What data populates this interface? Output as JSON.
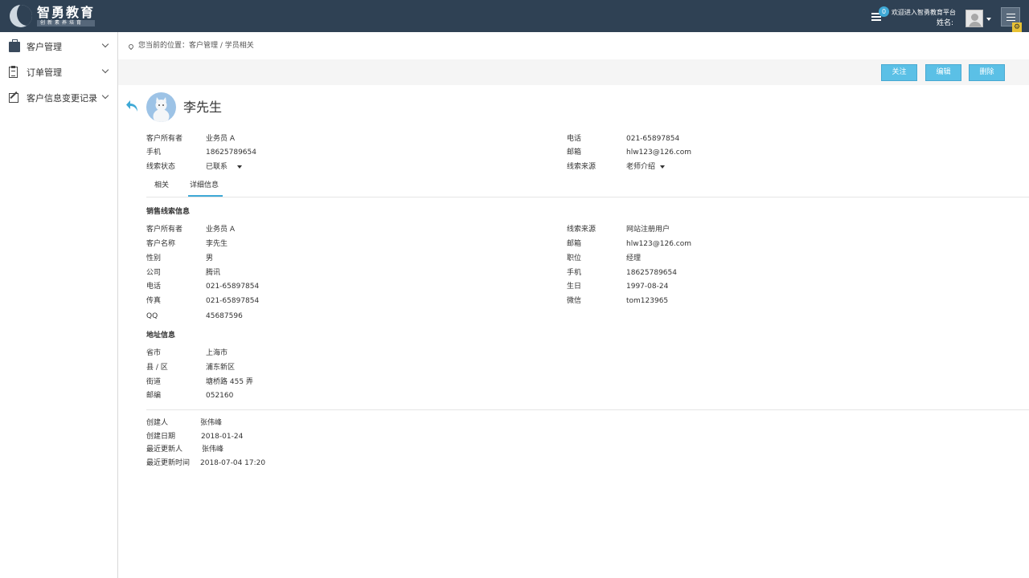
{
  "header": {
    "logo_title": "智勇教育",
    "logo_subtitle": "创新素养培育",
    "message_count": "0",
    "welcome": "欢迎进入智勇教育平台",
    "name_label": "姓名:"
  },
  "sidebar": {
    "items": [
      {
        "label": "客户管理",
        "icon": "briefcase-icon"
      },
      {
        "label": "订单管理",
        "icon": "clipboard-icon"
      },
      {
        "label": "客户信息变更记录",
        "icon": "edit-icon"
      }
    ]
  },
  "breadcrumb": "您当前的位置：客户管理 / 学员相关",
  "actions": {
    "follow": "关注",
    "edit": "编辑",
    "delete": "删除"
  },
  "customer": {
    "name": "李先生",
    "summary": {
      "owner_label": "客户所有者",
      "owner": "业务员 A",
      "mobile_label": "手机",
      "mobile": "18625789654",
      "status_label": "线索状态",
      "status": "已联系",
      "phone_label": "电话",
      "phone": "021-65897854",
      "email_label": "邮箱",
      "email": "hlw123@126.com",
      "source_label": "线索来源",
      "source": "老师介绍"
    }
  },
  "tabs": [
    {
      "label": "相关"
    },
    {
      "label": "详细信息"
    }
  ],
  "sales_section": {
    "title": "销售线索信息",
    "left": [
      {
        "label": "客户所有者",
        "value": "业务员 A"
      },
      {
        "label": "客户名称",
        "value": "李先生"
      },
      {
        "label": "性别",
        "value": "男"
      },
      {
        "label": "公司",
        "value": "腾讯"
      },
      {
        "label": "电话",
        "value": "021-65897854"
      },
      {
        "label": "传真",
        "value": "021-65897854"
      },
      {
        "label": "QQ",
        "value": "45687596"
      }
    ],
    "right": [
      {
        "label": "线索来源",
        "value": "网站注册用户"
      },
      {
        "label": "邮箱",
        "value": "hlw123@126.com"
      },
      {
        "label": "职位",
        "value": "经理"
      },
      {
        "label": "手机",
        "value": "18625789654"
      },
      {
        "label": "生日",
        "value": "1997-08-24"
      },
      {
        "label": "微信",
        "value": "tom123965"
      }
    ]
  },
  "address_section": {
    "title": "地址信息",
    "rows": [
      {
        "label": "省市",
        "value": "上海市"
      },
      {
        "label": "县 / 区",
        "value": "浦东新区"
      },
      {
        "label": "街道",
        "value": "塘桥路 455 弄"
      },
      {
        "label": "邮编",
        "value": "052160"
      }
    ]
  },
  "meta": {
    "rows": [
      {
        "label": "创建人",
        "value": "张伟峰"
      },
      {
        "label": "创建日期",
        "value": "2018-01-24"
      },
      {
        "label": "最近更新人",
        "value": "张伟峰"
      },
      {
        "label": "最近更新时间",
        "value": "2018-07-04 17:20"
      }
    ]
  },
  "colors": {
    "topbar": "#2f4154",
    "accent": "#5bc0e6",
    "tab_active": "#3fa9d6"
  }
}
